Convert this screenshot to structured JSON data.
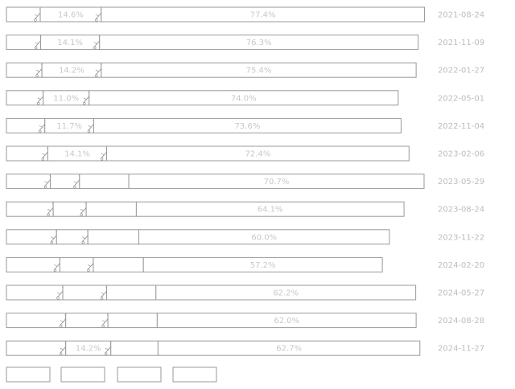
{
  "chart_data": {
    "type": "bar",
    "orientation": "horizontal",
    "stacked": "100%",
    "categories": [
      "2021-08-24",
      "2021-11-09",
      "2022-01-27",
      "2022-05-01",
      "2022-11-04",
      "2023-02-06",
      "2023-05-29",
      "2023-08-24",
      "2023-11-22",
      "2024-02-20",
      "2024-05-27",
      "2024-08-28",
      "2024-11-27"
    ],
    "series": [
      {
        "values": [
          8.1,
          8.2,
          8.5,
          8.8,
          9.2,
          9.9,
          10.5,
          11.2,
          12.0,
          12.8,
          13.5,
          14.2,
          14.2
        ]
      },
      {
        "values": [
          14.6,
          14.1,
          14.2,
          11.0,
          11.7,
          14.1,
          7.0,
          7.9,
          7.5,
          8.0,
          10.5,
          10.1,
          10.8
        ]
      },
      {
        "values": [
          0,
          0,
          0,
          0,
          0,
          0,
          11.8,
          12.0,
          12.2,
          12.0,
          11.8,
          11.8,
          11.3
        ]
      },
      {
        "values": [
          77.4,
          76.3,
          75.4,
          74.0,
          73.6,
          72.4,
          70.7,
          64.1,
          60.0,
          57.2,
          62.2,
          62.0,
          62.7
        ]
      }
    ],
    "labels": [
      [
        "",
        "14.6%",
        "",
        "77.4%"
      ],
      [
        "",
        "14.1%",
        "",
        "76.3%"
      ],
      [
        "",
        "14.2%",
        "",
        "75.4%"
      ],
      [
        "",
        "11.0%",
        "",
        "74.0%"
      ],
      [
        "",
        "11.7%",
        "",
        "73.6%"
      ],
      [
        "",
        "14.1%",
        "",
        "72.4%"
      ],
      [
        "",
        "",
        "",
        "70.7%"
      ],
      [
        "",
        "",
        "",
        "64.1%"
      ],
      [
        "",
        "",
        "",
        "60.0%"
      ],
      [
        "",
        "",
        "",
        "57.2%"
      ],
      [
        "",
        "",
        "",
        "62.2%"
      ],
      [
        "",
        "",
        "",
        "62.0%"
      ],
      [
        "",
        "14.2%",
        "",
        "62.7%"
      ]
    ],
    "xlim": [
      0,
      100
    ],
    "grid": false,
    "legend": "bottom-left"
  }
}
